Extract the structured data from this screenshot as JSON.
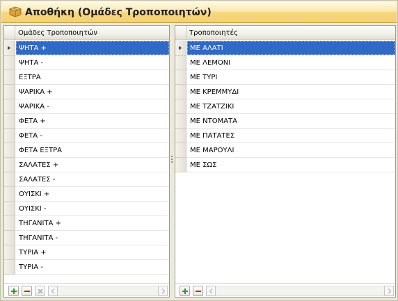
{
  "window": {
    "title": "Αποθήκη (Ομάδες Τροποποιητών)",
    "icon": "package-box-icon"
  },
  "left_grid": {
    "column_header": "Ομάδες Τροποποιητών",
    "selected_index": 0,
    "rows": [
      "ΨΗΤΑ +",
      "ΨΗΤΑ -",
      "ΕΞΤΡΑ",
      "ΨΑΡΙΚΑ +",
      "ΨΑΡΙΚΑ -",
      "ΦΕΤΑ +",
      "ΦΕΤΑ -",
      "ΦΕΤΑ ΕΞΤΡΑ",
      "ΣΑΛΑΤΕΣ +",
      "ΣΑΛΑΤΕΣ -",
      "ΟΥΙΣΚΙ +",
      "ΟΥΙΣΚΙ -",
      "ΤΗΓΑΝΙΤΑ +",
      "ΤΗΓΑΝΙΤΑ -",
      "ΤΥΡΙΑ +",
      "ΤΥΡΙΑ -"
    ],
    "footer_buttons": [
      "add-icon",
      "remove-icon",
      "clear-icon"
    ]
  },
  "right_grid": {
    "column_header": "Τροποποιητές",
    "selected_index": 0,
    "rows": [
      "ΜΕ ΑΛΑΤΙ",
      "ΜΕ ΛΕΜΟΝΙ",
      "ΜΕ ΤΥΡΙ",
      "ΜΕ ΚΡΕΜΜΥΔΙ",
      "ΜΕ ΤΖΑΤΖΙΚΙ",
      "ΜΕ ΝΤΟΜΑΤΑ",
      "ΜΕ ΠΑΤΑΤΕΣ",
      "ΜΕ ΜΑΡΟΥΛΙ",
      "ΜΕ ΣΩΣ"
    ],
    "footer_buttons": [
      "add-icon",
      "remove-icon"
    ]
  },
  "colors": {
    "selection": "#3169c6",
    "add_icon": "#2e9a1e",
    "remove_icon": "#c8281c",
    "title_gradient_top": "#fefae8",
    "title_gradient_bottom": "#f3d272"
  }
}
